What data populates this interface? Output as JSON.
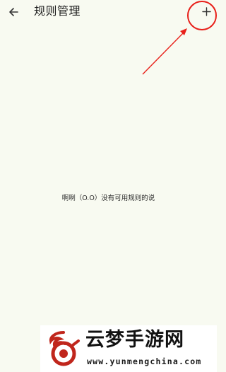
{
  "app_bar": {
    "title": "规则管理",
    "back_icon": "arrow-left-icon",
    "add_icon": "plus-icon"
  },
  "main": {
    "empty_message": "啊咧（O.O）没有可用规则的说"
  },
  "annotation": {
    "color": "#e8201a"
  },
  "watermark": {
    "name": "云梦手游网",
    "url": "www.yunmengchina.com",
    "logo_color": "#c0261c"
  }
}
